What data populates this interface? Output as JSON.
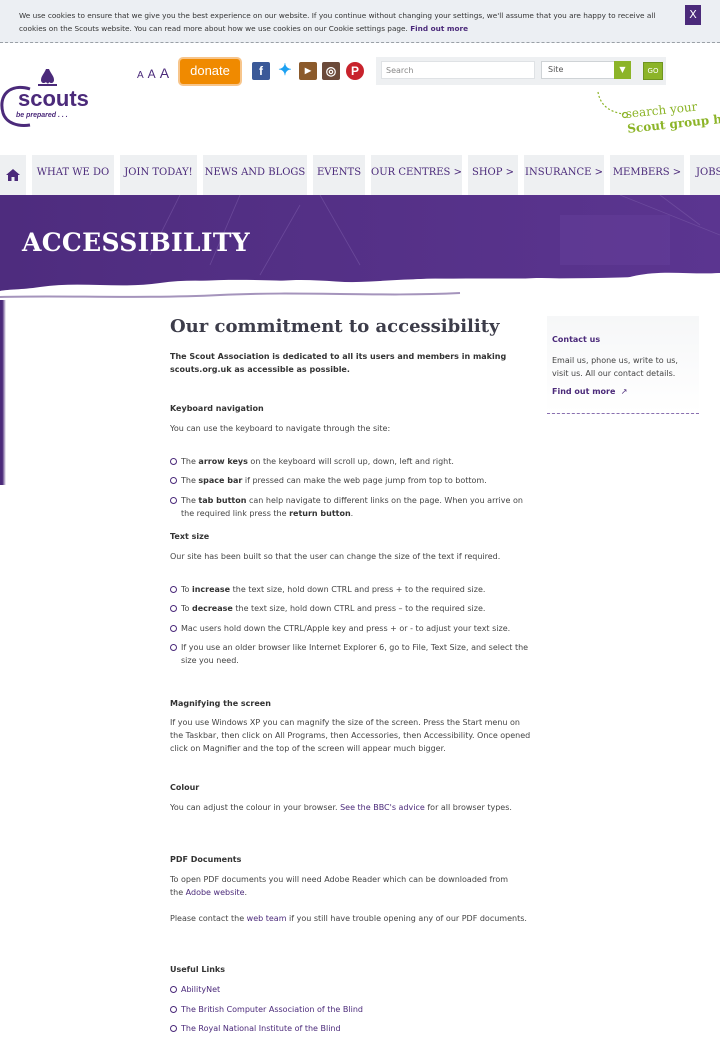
{
  "cookie": {
    "text": "We use cookies to ensure that we give you the best experience on our website. If you continue without changing your settings, we'll assume that you are happy to receive all cookies on the Scouts website. You can read more about how we use cookies on our Cookie settings page.",
    "link": "Find out more",
    "close": "X"
  },
  "header": {
    "logo_word": "scouts",
    "logo_tag": "be prepared . . .",
    "font_sizes": [
      "A",
      "A",
      "A"
    ],
    "donate": "donate",
    "social": [
      {
        "name": "facebook-icon",
        "glyph": "f",
        "color": "#3b5998"
      },
      {
        "name": "twitter-icon",
        "glyph": "t",
        "color": "#1da1f2"
      },
      {
        "name": "youtube-icon",
        "glyph": "▶",
        "color": "#8b5a2b"
      },
      {
        "name": "instagram-icon",
        "glyph": "◎",
        "color": "#6b4a3a"
      },
      {
        "name": "pinterest-icon",
        "glyph": "P",
        "color": "#c8232c"
      }
    ],
    "search_placeholder": "Search",
    "site_select": "Site",
    "go": "GO",
    "tagline_1": "search your",
    "tagline_2": "Scout group here"
  },
  "nav": {
    "items": [
      "WHAT WE DO",
      "JOIN TODAY!",
      "NEWS AND BLOGS",
      "EVENTS",
      "OUR CENTRES >",
      "SHOP >",
      "INSURANCE >",
      "MEMBERS >",
      "JOBS"
    ]
  },
  "banner": {
    "title": "ACCESSIBILITY"
  },
  "content": {
    "heading": "Our commitment to accessibility",
    "intro": "The Scout Association is dedicated to all its users and members in making scouts.org.uk as accessible as possible.",
    "keyboard_title": "Keyboard navigation",
    "keyboard_text": "You can use the keyboard to navigate through the site:",
    "keyboard_items": [
      {
        "pre": "The ",
        "bold": "arrow keys",
        "post": " on the keyboard will scroll up, down, left and right."
      },
      {
        "pre": "The ",
        "bold": "space bar",
        "post": " if pressed can make the web page jump from top to bottom."
      },
      {
        "pre": "The ",
        "bold": "tab button",
        "post": " can help navigate to different links on the page. When you arrive on the required link press the ",
        "bold2": "return button",
        "post2": "."
      }
    ],
    "text_size_title": "Text size",
    "text_size_text": "Our site has been built so that the user can change the size of the text if required.",
    "text_size_items": [
      {
        "pre": "To ",
        "bold": "increase",
        "post": " the text size, hold down CTRL and press + to the required size."
      },
      {
        "pre": "To ",
        "bold": "decrease",
        "post": " the text size, hold down CTRL and press – to the required size."
      },
      {
        "pre": "",
        "bold": "",
        "post": "Mac users hold down the CTRL/Apple key and press + or - to adjust your text size."
      },
      {
        "pre": "",
        "bold": "",
        "post": "If you use an older browser like Internet Explorer 6, go to File, Text Size, and select the size you need."
      }
    ],
    "magnify_title": "Magnifying the screen",
    "magnify_text": "If you use Windows XP you can magnify the size of the screen. Press the Start menu on the Taskbar, then click on All Programs, then Accessories, then Accessibility. Once opened click on Magnifier and the top of the screen will appear much bigger.",
    "colour_title": "Colour",
    "colour_text_pre": "You can adjust the colour in your browser. ",
    "colour_link": "See the BBC's advice",
    "colour_text_post": " for all browser types.",
    "pdf_title": "PDF Documents",
    "pdf_text_pre": "To open PDF documents you will need Adobe Reader which can be downloaded from the ",
    "pdf_link": "Adobe website",
    "pdf_text_post": ".",
    "contact_pre": "Please contact the ",
    "contact_link": "web team",
    "contact_post": " if you still have trouble opening any of our PDF documents.",
    "links_title": "Useful Links",
    "useful_links": [
      "AbilityNet",
      "The British Computer Association of the Blind",
      "The Royal National Institute of the Blind"
    ]
  },
  "sidebar": {
    "title": "Contact us",
    "text": "Email us, phone us, write to us, visit us. All our contact details.",
    "link": "Find out more"
  }
}
